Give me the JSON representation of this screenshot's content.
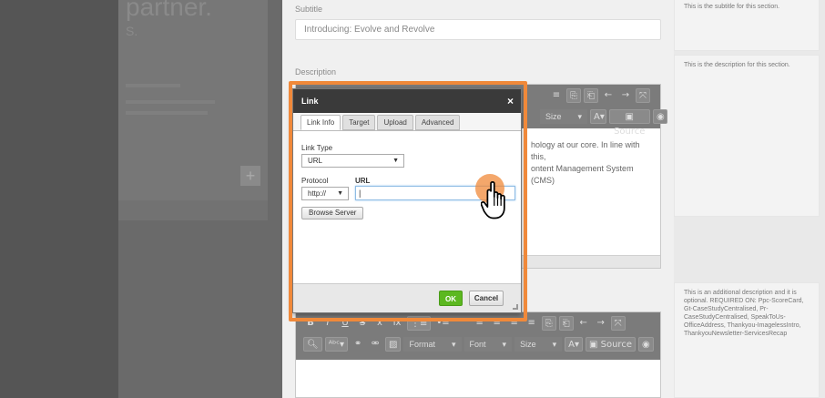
{
  "left_panel": {
    "heading_fragment": "partner.",
    "sub_fragment": "S."
  },
  "subtitle": {
    "label": "Subtitle",
    "value": "Introducing: Evolve and Revolve"
  },
  "description": {
    "label": "Description",
    "body_line1": "hology at our core. In line with this,",
    "body_line2": "ontent Management System (CMS)"
  },
  "toolbar": {
    "bold": "B",
    "italic": "I",
    "underline": "U",
    "strike": "S",
    "subscript": "x",
    "remove_format": "Ix",
    "format": "Format",
    "font": "Font",
    "size": "Size",
    "text_color": "A",
    "source": "Source"
  },
  "help": {
    "subtitle_text": "This is the subtitle for this section.",
    "description_text": "This is the description for this section.",
    "additional_text": "This is an additional description and it is optional. REQUIRED ON: Ppc-ScoreCard, Gt-CaseStudyCentralised, Pr-CaseStudyCentralised, SpeakToUs-OfficeAddress, Thankyou-ImagelessIntro, ThankyouNewsletter-ServicesRecap"
  },
  "dialog": {
    "title": "Link",
    "close": "×",
    "tabs": [
      "Link Info",
      "Target",
      "Upload",
      "Advanced"
    ],
    "link_type_label": "Link Type",
    "link_type_value": "URL",
    "protocol_label": "Protocol",
    "protocol_value": "http://",
    "url_label": "URL",
    "url_value": "|",
    "browse_label": "Browse Server",
    "ok_label": "OK",
    "cancel_label": "Cancel"
  },
  "colors": {
    "highlight": "#f0893a",
    "ok_button": "#5cb820",
    "dialog_title": "#3a3a3a"
  }
}
